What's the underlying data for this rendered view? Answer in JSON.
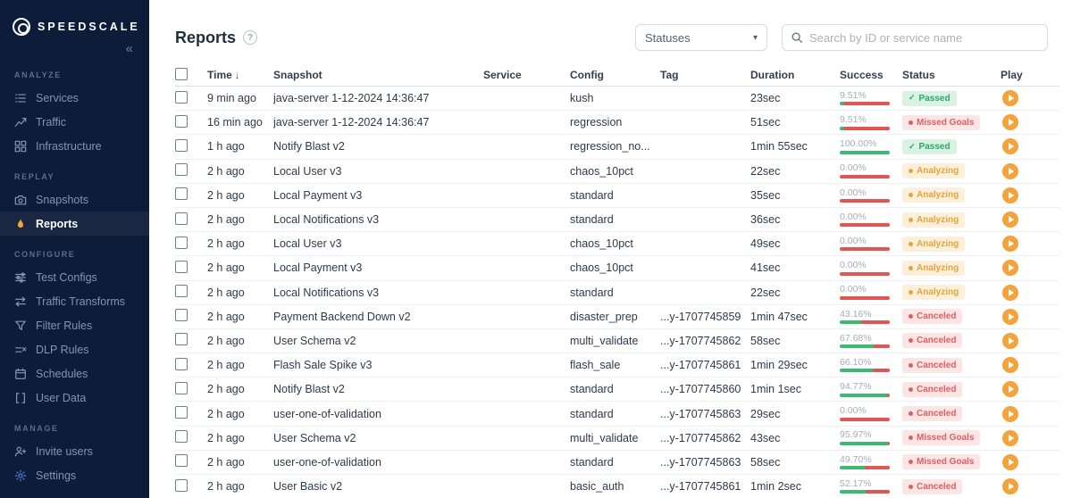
{
  "sidebar": {
    "logo": "SPEEDSCALE",
    "collapse": "«",
    "sections": [
      {
        "label": "ANALYZE",
        "items": [
          {
            "name": "services",
            "label": "Services",
            "icon": "services-icon"
          },
          {
            "name": "traffic",
            "label": "Traffic",
            "icon": "traffic-icon"
          },
          {
            "name": "infrastructure",
            "label": "Infrastructure",
            "icon": "infrastructure-icon"
          }
        ]
      },
      {
        "label": "REPLAY",
        "items": [
          {
            "name": "snapshots",
            "label": "Snapshots",
            "icon": "camera-icon"
          },
          {
            "name": "reports",
            "label": "Reports",
            "icon": "flame-icon",
            "active": true
          }
        ]
      },
      {
        "label": "CONFIGURE",
        "items": [
          {
            "name": "test-configs",
            "label": "Test Configs",
            "icon": "sliders-icon"
          },
          {
            "name": "traffic-transforms",
            "label": "Traffic Transforms",
            "icon": "transform-arrows-icon"
          },
          {
            "name": "filter-rules",
            "label": "Filter Rules",
            "icon": "funnel-icon"
          },
          {
            "name": "dlp-rules",
            "label": "DLP Rules",
            "icon": "dlp-icon"
          },
          {
            "name": "schedules",
            "label": "Schedules",
            "icon": "calendar-icon"
          },
          {
            "name": "user-data",
            "label": "User Data",
            "icon": "brackets-icon"
          }
        ]
      },
      {
        "label": "MANAGE",
        "items": [
          {
            "name": "invite-users",
            "label": "Invite users",
            "icon": "person-plus-icon"
          },
          {
            "name": "settings",
            "label": "Settings",
            "icon": "gear-icon"
          }
        ]
      }
    ]
  },
  "header": {
    "title": "Reports",
    "statuses": "Statuses",
    "search_placeholder": "Search by ID or service name"
  },
  "table": {
    "columns": [
      "Time",
      "Snapshot",
      "Service",
      "Config",
      "Tag",
      "Duration",
      "Success",
      "Status",
      "Play"
    ],
    "sort_icon": "↓",
    "rows": [
      {
        "time": "9 min ago",
        "snapshot": "java-server 1-12-2024 14:36:47",
        "service": "",
        "config": "kush",
        "tag": "",
        "duration": "23sec",
        "success": "9.51%",
        "success_pct": 9.51,
        "status": "Passed",
        "status_type": "passed"
      },
      {
        "time": "16 min ago",
        "snapshot": "java-server 1-12-2024 14:36:47",
        "service": "",
        "config": "regression",
        "tag": "",
        "duration": "51sec",
        "success": "9.51%",
        "success_pct": 9.51,
        "status": "Missed Goals",
        "status_type": "missed"
      },
      {
        "time": "1 h ago",
        "snapshot": "Notify Blast v2",
        "service": "",
        "config": "regression_no...",
        "tag": "",
        "duration": "1min 55sec",
        "success": "100.00%",
        "success_pct": 100,
        "status": "Passed",
        "status_type": "passed"
      },
      {
        "time": "2 h ago",
        "snapshot": "Local User v3",
        "service": "",
        "config": "chaos_10pct",
        "tag": "",
        "duration": "22sec",
        "success": "0.00%",
        "success_pct": 0,
        "status": "Analyzing",
        "status_type": "analyzing"
      },
      {
        "time": "2 h ago",
        "snapshot": "Local Payment v3",
        "service": "",
        "config": "standard",
        "tag": "",
        "duration": "35sec",
        "success": "0.00%",
        "success_pct": 0,
        "status": "Analyzing",
        "status_type": "analyzing"
      },
      {
        "time": "2 h ago",
        "snapshot": "Local Notifications v3",
        "service": "",
        "config": "standard",
        "tag": "",
        "duration": "36sec",
        "success": "0.00%",
        "success_pct": 0,
        "status": "Analyzing",
        "status_type": "analyzing"
      },
      {
        "time": "2 h ago",
        "snapshot": "Local User v3",
        "service": "",
        "config": "chaos_10pct",
        "tag": "",
        "duration": "49sec",
        "success": "0.00%",
        "success_pct": 0,
        "status": "Analyzing",
        "status_type": "analyzing"
      },
      {
        "time": "2 h ago",
        "snapshot": "Local Payment v3",
        "service": "",
        "config": "chaos_10pct",
        "tag": "",
        "duration": "41sec",
        "success": "0.00%",
        "success_pct": 0,
        "status": "Analyzing",
        "status_type": "analyzing"
      },
      {
        "time": "2 h ago",
        "snapshot": "Local Notifications v3",
        "service": "",
        "config": "standard",
        "tag": "",
        "duration": "22sec",
        "success": "0.00%",
        "success_pct": 0,
        "status": "Analyzing",
        "status_type": "analyzing"
      },
      {
        "time": "2 h ago",
        "snapshot": "Payment Backend Down v2",
        "service": "",
        "config": "disaster_prep",
        "tag": "...y-1707745859",
        "duration": "1min 47sec",
        "success": "43.16%",
        "success_pct": 43.16,
        "status": "Canceled",
        "status_type": "canceled"
      },
      {
        "time": "2 h ago",
        "snapshot": "User Schema v2",
        "service": "",
        "config": "multi_validate",
        "tag": "...y-1707745862",
        "duration": "58sec",
        "success": "67.68%",
        "success_pct": 67.68,
        "status": "Canceled",
        "status_type": "canceled"
      },
      {
        "time": "2 h ago",
        "snapshot": "Flash Sale Spike v3",
        "service": "",
        "config": "flash_sale",
        "tag": "...y-1707745861",
        "duration": "1min 29sec",
        "success": "66.10%",
        "success_pct": 66.1,
        "status": "Canceled",
        "status_type": "canceled"
      },
      {
        "time": "2 h ago",
        "snapshot": "Notify Blast v2",
        "service": "",
        "config": "standard",
        "tag": "...y-1707745860",
        "duration": "1min 1sec",
        "success": "94.77%",
        "success_pct": 94.77,
        "status": "Canceled",
        "status_type": "canceled"
      },
      {
        "time": "2 h ago",
        "snapshot": "user-one-of-validation",
        "service": "",
        "config": "standard",
        "tag": "...y-1707745863",
        "duration": "29sec",
        "success": "0.00%",
        "success_pct": 0,
        "status": "Canceled",
        "status_type": "canceled"
      },
      {
        "time": "2 h ago",
        "snapshot": "User Schema v2",
        "service": "",
        "config": "multi_validate",
        "tag": "...y-1707745862",
        "duration": "43sec",
        "success": "95.97%",
        "success_pct": 95.97,
        "status": "Missed Goals",
        "status_type": "missed"
      },
      {
        "time": "2 h ago",
        "snapshot": "user-one-of-validation",
        "service": "",
        "config": "standard",
        "tag": "...y-1707745863",
        "duration": "58sec",
        "success": "49.70%",
        "success_pct": 49.7,
        "status": "Missed Goals",
        "status_type": "missed"
      },
      {
        "time": "2 h ago",
        "snapshot": "User Basic v2",
        "service": "",
        "config": "basic_auth",
        "tag": "...y-1707745861",
        "duration": "1min 2sec",
        "success": "52.17%",
        "success_pct": 52.17,
        "status": "Canceled",
        "status_type": "canceled"
      }
    ]
  },
  "colors": {
    "sidebar_bg": "#0d1c38",
    "accent_orange": "#f2a33c",
    "success_green": "#3bbb72",
    "fail_red": "#e25555",
    "badge_green_bg": "#d9f2e4",
    "badge_red_bg": "#fbe5e5",
    "badge_orange_bg": "#fcf0da"
  }
}
